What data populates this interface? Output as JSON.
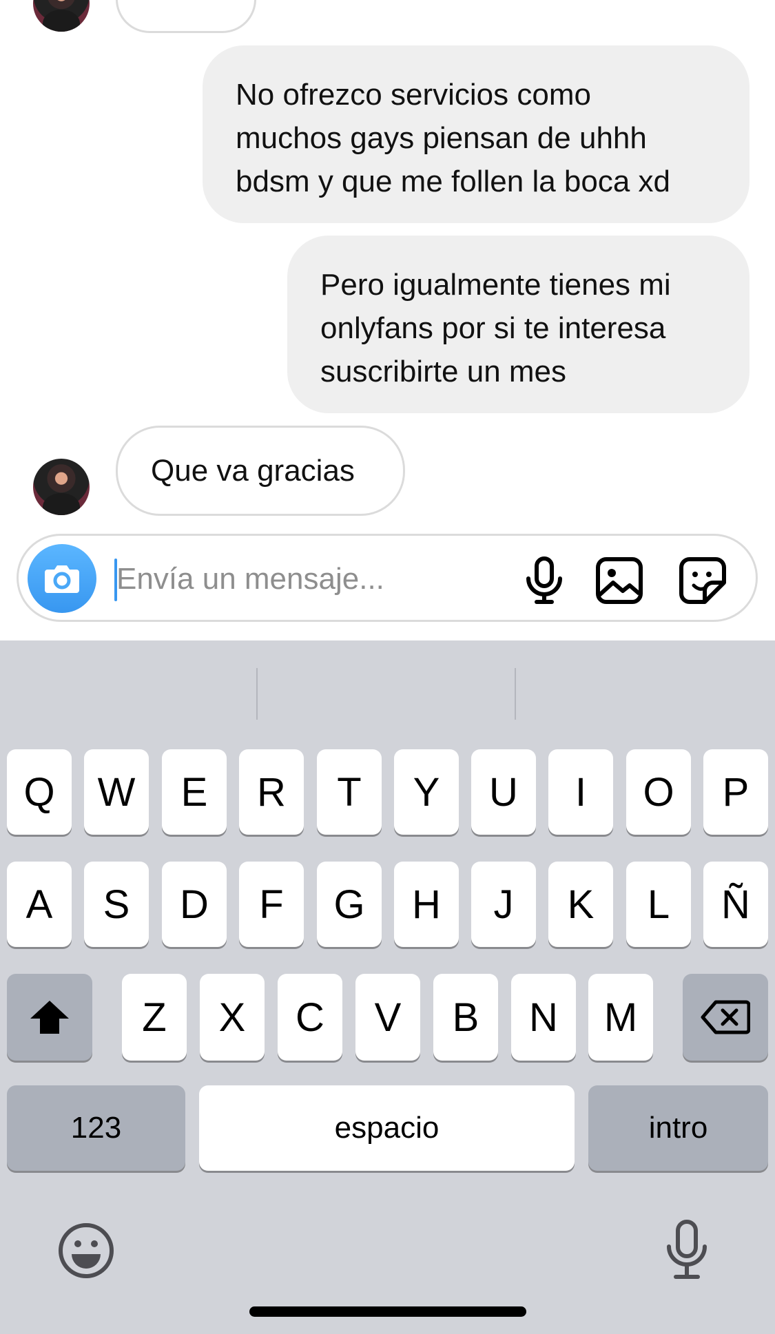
{
  "conversation": {
    "messages": [
      {
        "from": "them",
        "text": ""
      },
      {
        "from": "me",
        "lines": [
          "No ofrezco servicios como",
          "muchos gays piensan de uhhh",
          "bdsm y que me follen la boca xd"
        ]
      },
      {
        "from": "me",
        "lines": [
          "Pero igualmente tienes mi",
          "onlyfans por si te interesa",
          "suscribirte un mes"
        ]
      },
      {
        "from": "them",
        "text": "Que va gracias"
      }
    ]
  },
  "composer": {
    "placeholder": "Envía un mensaje...",
    "value": "",
    "icons": [
      "camera-icon",
      "microphone-icon",
      "gallery-icon",
      "sticker-icon"
    ]
  },
  "keyboard": {
    "row1": [
      "Q",
      "W",
      "E",
      "R",
      "T",
      "Y",
      "U",
      "I",
      "O",
      "P"
    ],
    "row2": [
      "A",
      "S",
      "D",
      "F",
      "G",
      "H",
      "J",
      "K",
      "L",
      "Ñ"
    ],
    "row3": [
      "Z",
      "X",
      "C",
      "V",
      "B",
      "N",
      "M"
    ],
    "numbers_label": "123",
    "space_label": "espacio",
    "return_label": "intro",
    "icons": [
      "shift-icon",
      "backspace-icon",
      "emoji-icon",
      "dictation-icon"
    ]
  },
  "colors": {
    "accent": "#3897f0",
    "incoming_border": "#dbdbdb",
    "outgoing_bubble": "#efefef",
    "keyboard_bg": "#d1d3d9",
    "special_key": "#abb0ba"
  }
}
